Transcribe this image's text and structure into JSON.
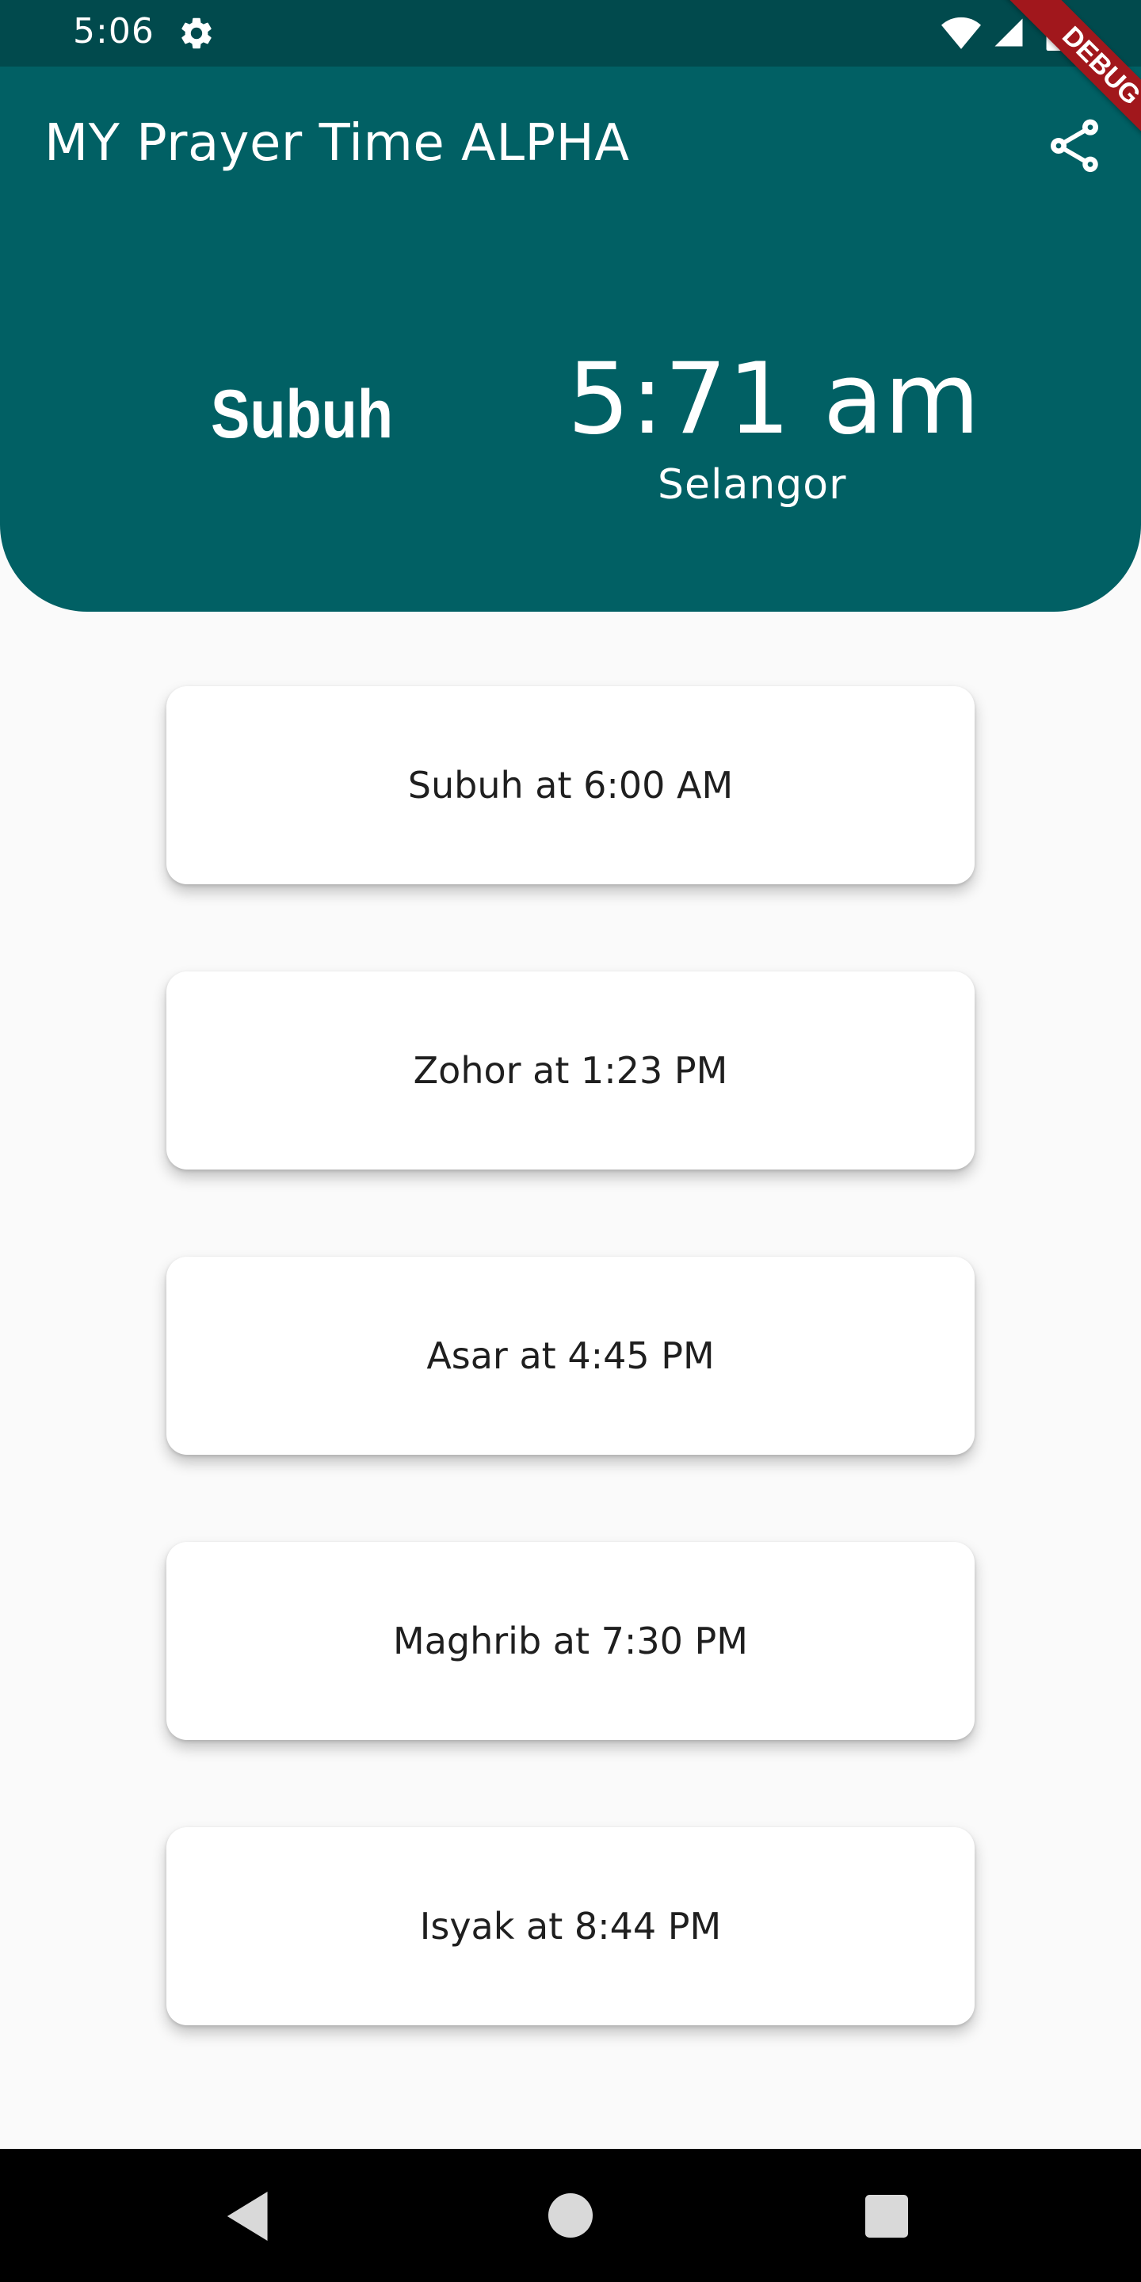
{
  "status_bar": {
    "time": "5:06",
    "icons": [
      "gear-icon",
      "wifi-icon",
      "signal-icon",
      "battery-icon"
    ]
  },
  "app_bar": {
    "title": "MY Prayer Time ALPHA",
    "action_icon": "share-icon"
  },
  "current": {
    "prayer_name": "Subuh",
    "time": "5:71 am",
    "location": "Selangor"
  },
  "prayers": [
    {
      "label": "Subuh at 6:00 AM"
    },
    {
      "label": "Zohor at 1:23 PM"
    },
    {
      "label": "Asar at 4:45 PM"
    },
    {
      "label": "Maghrib at 7:30 PM"
    },
    {
      "label": "Isyak at 8:44 PM"
    }
  ],
  "debug_banner": "DEBUG",
  "colors": {
    "header_background": "#016064",
    "status_bar_background": "#014a4d",
    "page_background": "#fafafa",
    "card_background": "#ffffff",
    "debug_banner": "#a1171c"
  },
  "nav_bar": {
    "icons": [
      "back-icon",
      "home-icon",
      "recents-icon"
    ]
  }
}
